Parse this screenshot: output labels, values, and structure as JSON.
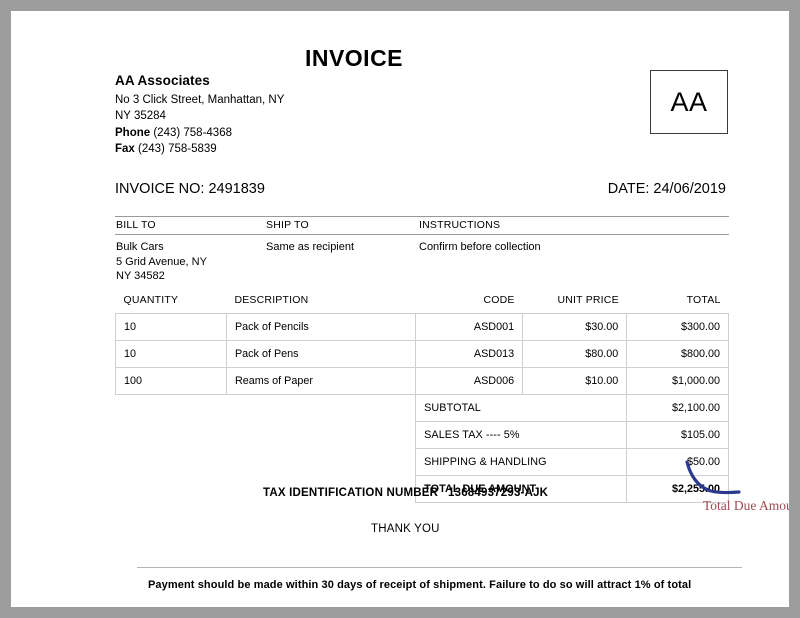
{
  "document": {
    "title": "INVOICE",
    "logo_text": "AA"
  },
  "seller": {
    "name": "AA Associates",
    "address_line1": "No 3 Click Street, Manhattan, NY",
    "address_line2": "NY 35284",
    "phone_label": "Phone",
    "phone_value": "(243) 758-4368",
    "fax_label": "Fax",
    "fax_value": "(243) 758-5839"
  },
  "meta": {
    "invoice_no": "INVOICE NO: 2491839",
    "date": "DATE: 24/06/2019"
  },
  "parties": {
    "headers": [
      "BILL TO",
      "SHIP TO",
      "INSTRUCTIONS"
    ],
    "bill_to": [
      "Bulk Cars",
      "5 Grid Avenue, NY",
      "NY 34582"
    ],
    "ship_to": "Same as recipient",
    "instructions": "Confirm before collection"
  },
  "items": {
    "headers": [
      "QUANTITY",
      "DESCRIPTION",
      "CODE",
      "UNIT PRICE",
      "TOTAL"
    ],
    "rows": [
      {
        "quantity": "10",
        "description": "Pack of Pencils",
        "code": "ASD001",
        "unit_price": "$30.00",
        "total": "$300.00"
      },
      {
        "quantity": "10",
        "description": "Pack of Pens",
        "code": "ASD013",
        "unit_price": "$80.00",
        "total": "$800.00"
      },
      {
        "quantity": "100",
        "description": "Reams of Paper",
        "code": "ASD006",
        "unit_price": "$10.00",
        "total": "$1,000.00"
      }
    ],
    "summary": [
      {
        "label": "SUBTOTAL",
        "value": "$2,100.00"
      },
      {
        "label": "SALES TAX ---- 5%",
        "value": "$105.00"
      },
      {
        "label": "SHIPPING & HANDLING",
        "value": "$50.00"
      },
      {
        "label": "TOTAL DUE AMOUNT",
        "value": "$2,255.00"
      }
    ]
  },
  "tax": {
    "label": "TAX IDENTIFICATION NUMBER",
    "value": "13684937293-AJK"
  },
  "thank_you": "THANK YOU",
  "annotation": {
    "label": "Total Due Amount",
    "arrow_color": "#2b3a8f",
    "label_color": "#a14a54"
  },
  "footer": {
    "note": "Payment should be made within 30 days of receipt of shipment. Failure to do so will attract 1% of total"
  },
  "colors": {
    "page_background": "#ffffff",
    "canvas_background": "#9d9d9d",
    "table_border": "#cfcfcf",
    "rule": "#9a9a9a"
  }
}
